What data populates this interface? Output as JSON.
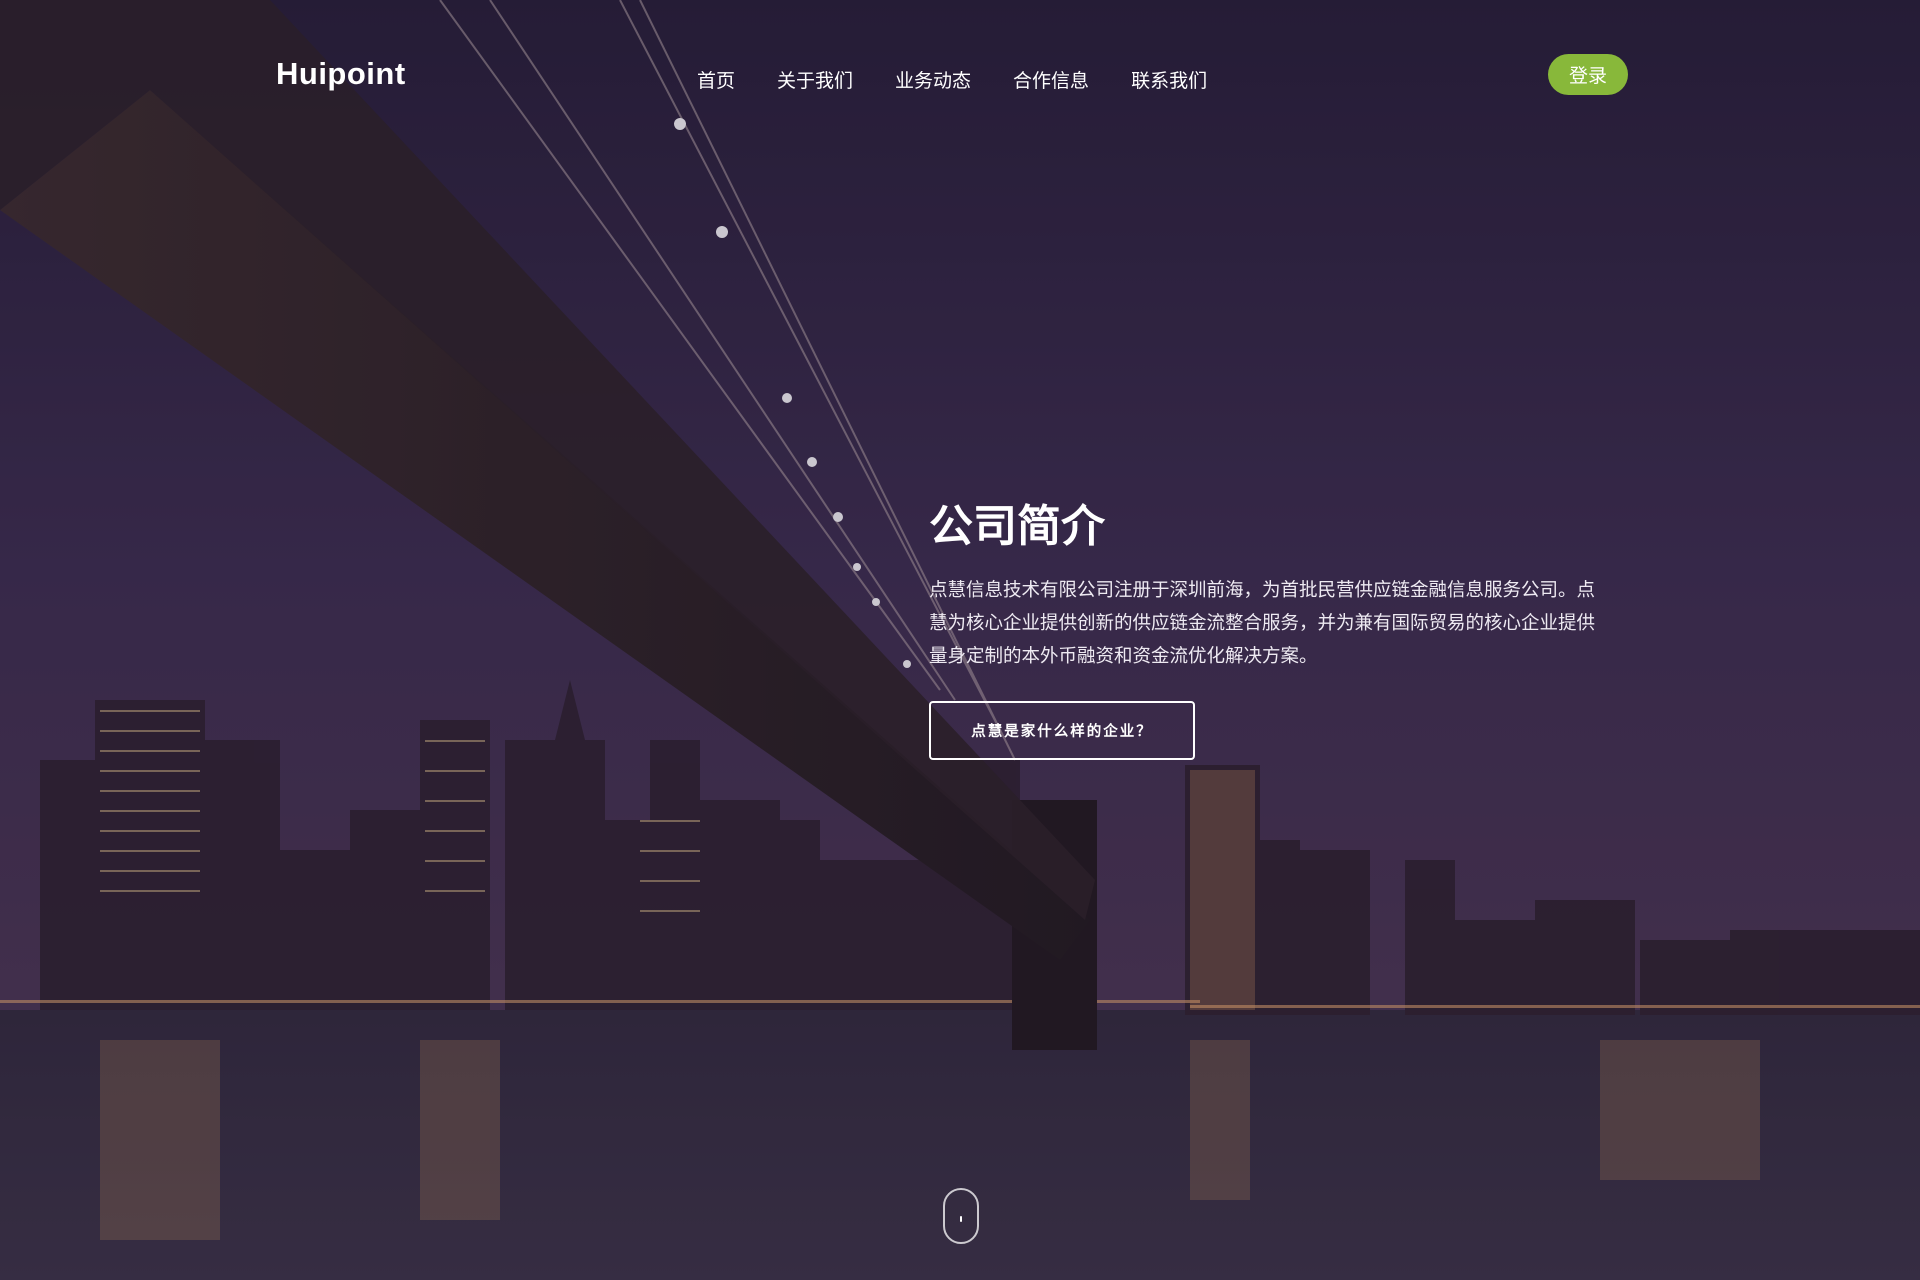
{
  "brand": {
    "name": "Huipoint"
  },
  "nav": {
    "items": [
      {
        "label": "首页"
      },
      {
        "label": "关于我们"
      },
      {
        "label": "业务动态"
      },
      {
        "label": "合作信息"
      },
      {
        "label": "联系我们"
      }
    ],
    "login_label": "登录"
  },
  "intro": {
    "title": "公司简介",
    "body": "点慧信息技术有限公司注册于深圳前海，为首批民营供应链金融信息服务公司。点慧为核心企业提供创新的供应链金流整合服务，并为兼有国际贸易的核心企业提供量身定制的本外币融资和资金流优化解决方案。",
    "cta_label": "点慧是家什么样的企业？"
  },
  "colors": {
    "accent": "#88b83a",
    "overlay": "#2a2140"
  },
  "icons": {
    "scroll": "mouse-scroll-icon"
  }
}
